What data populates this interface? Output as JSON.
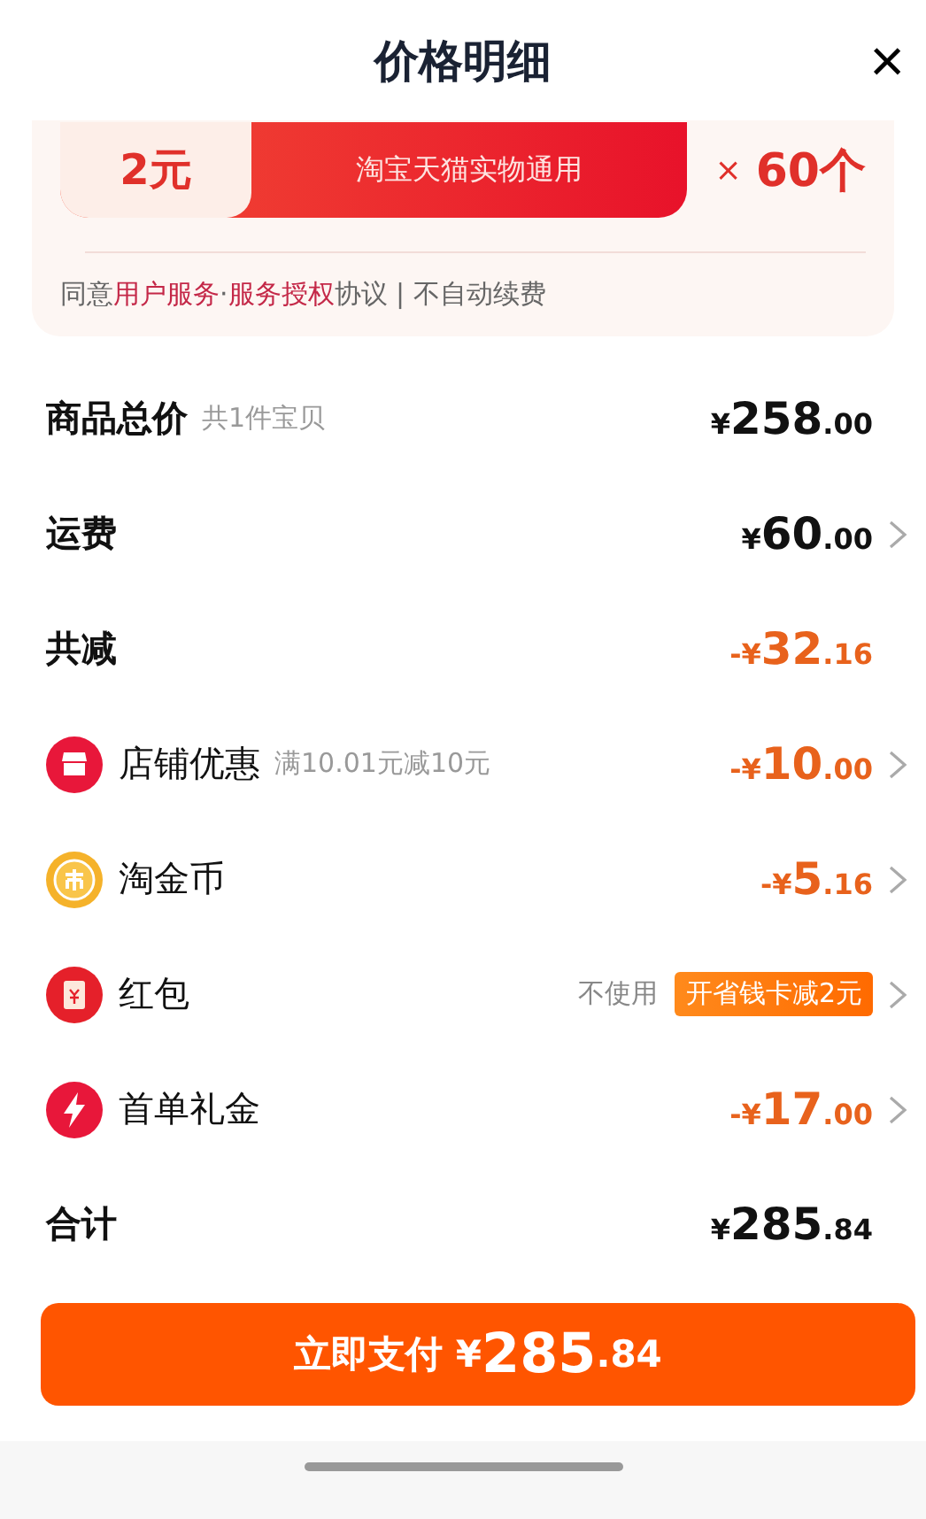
{
  "header": {
    "title": "价格明细",
    "close": "×"
  },
  "coupon": {
    "value": "2元",
    "subtitle": "淘宝天猫实物通用",
    "times": "×",
    "count": "60个"
  },
  "agreement": {
    "before": "同意",
    "link_1": "用户服务",
    "separator": "·",
    "link_2": "服务授权",
    "after": "协议 | 不自动续费"
  },
  "rows": [
    {
      "kind": "plain",
      "label": "商品总价",
      "note": "共1件宝贝",
      "amount": {
        "prefix": "¥",
        "integer": "258",
        "decimal": ".00"
      },
      "discount": false,
      "arrow": false
    },
    {
      "kind": "plain",
      "label": "运费",
      "amount": {
        "prefix": "¥",
        "integer": "60",
        "decimal": ".00"
      },
      "discount": false,
      "arrow": true
    },
    {
      "kind": "plain",
      "label": "共减",
      "amount": {
        "prefix": "-¥",
        "integer": "32",
        "decimal": ".16"
      },
      "discount": true,
      "arrow": false
    },
    {
      "kind": "shop",
      "label": "店铺优惠",
      "note": "满10.01元减10元",
      "amount": {
        "prefix": "-¥",
        "integer": "10",
        "decimal": ".00"
      },
      "discount": true,
      "arrow": true
    },
    {
      "kind": "coin",
      "label": "淘金币",
      "amount": {
        "prefix": "-¥",
        "integer": "5",
        "decimal": ".16"
      },
      "discount": true,
      "arrow": true
    },
    {
      "kind": "packet",
      "label": "红包",
      "status": "不使用",
      "badge": "开省钱卡减2元",
      "arrow": true
    },
    {
      "kind": "bolt",
      "label": "首单礼金",
      "amount": {
        "prefix": "-¥",
        "integer": "17",
        "decimal": ".00"
      },
      "discount": true,
      "arrow": true
    },
    {
      "kind": "plain",
      "label": "合计",
      "amount": {
        "prefix": "¥",
        "integer": "285",
        "decimal": ".84"
      },
      "discount": false,
      "arrow": false
    }
  ],
  "pay_button": {
    "label": "立即支付",
    "amount": {
      "prefix": "¥",
      "integer": "285",
      "decimal": ".84"
    }
  }
}
